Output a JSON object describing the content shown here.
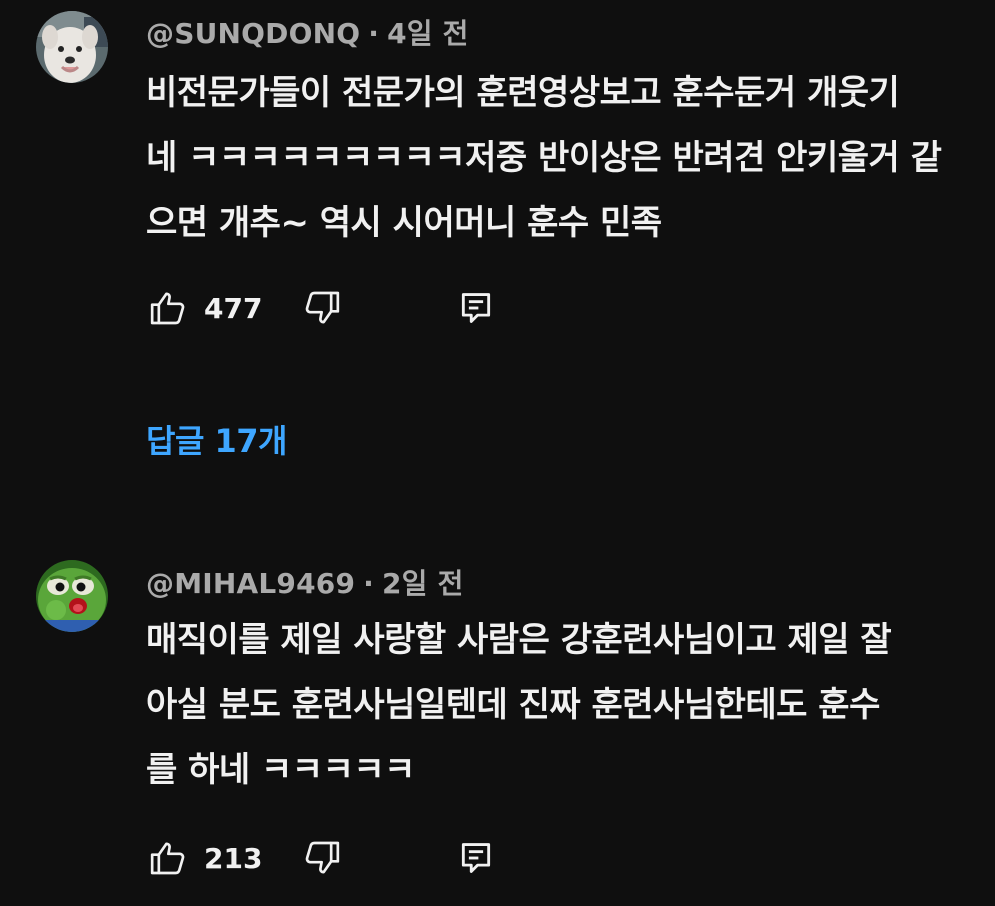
{
  "colors": {
    "background": "#0f0f0f",
    "text": "#f1f1f1",
    "meta": "#aaaaaa",
    "link": "#3ea6ff"
  },
  "comments": [
    {
      "author": "@SUNQDONQ",
      "separator": "·",
      "time": "4일 전",
      "text": "비전문가들이 전문가의 훈련영상보고 훈수둔거 개웃기\n네 ㅋㅋㅋㅋㅋㅋㅋㅋㅋ저중 반이상은 반려견 안키울거 같\n으면 개추~ 역시 시어머니 훈수 민족",
      "likes": "477",
      "avatar_icon": "white-dog-avatar",
      "replies_label": "답글 17개"
    },
    {
      "author": "@MIHAL9469",
      "separator": "·",
      "time": "2일 전",
      "text": "매직이를 제일 사랑할 사람은 강훈련사님이고 제일 잘\n아실 분도 훈련사님일텐데 진짜 훈련사님한테도 훈수\n를 하네 ㅋㅋㅋㅋㅋ",
      "likes": "213",
      "avatar_icon": "green-frog-avatar"
    }
  ],
  "icons": {
    "like": "thumbs-up-icon",
    "dislike": "thumbs-down-icon",
    "reply": "reply-comment-icon"
  }
}
